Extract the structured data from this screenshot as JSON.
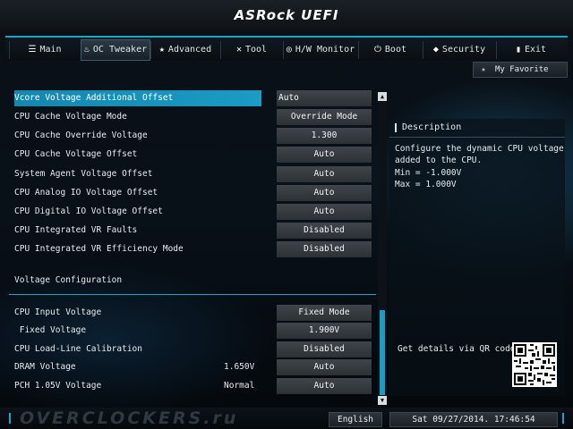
{
  "header": {
    "logo": "ASRock UEFI"
  },
  "tabs": [
    {
      "label": "Main",
      "icon": "list-icon",
      "glyph": "☰",
      "active": false
    },
    {
      "label": "OC Tweaker",
      "icon": "flame-icon",
      "glyph": "♨",
      "active": true
    },
    {
      "label": "Advanced",
      "icon": "star-icon",
      "glyph": "★",
      "active": false
    },
    {
      "label": "Tool",
      "icon": "tools-icon",
      "glyph": "✕",
      "active": false
    },
    {
      "label": "H/W Monitor",
      "icon": "monitor-icon",
      "glyph": "◎",
      "active": false
    },
    {
      "label": "Boot",
      "icon": "power-icon",
      "glyph": "⏻",
      "active": false
    },
    {
      "label": "Security",
      "icon": "shield-icon",
      "glyph": "◆",
      "active": false
    },
    {
      "label": "Exit",
      "icon": "exit-icon",
      "glyph": "▮",
      "active": false
    }
  ],
  "favorite": {
    "label": "My Favorite",
    "icon": "star-icon"
  },
  "settings": [
    {
      "name": "Vcore Voltage Additional Offset",
      "value": "Auto",
      "selected": true
    },
    {
      "name": "CPU Cache Voltage Mode",
      "value": "Override Mode"
    },
    {
      "name": "CPU Cache Override Voltage",
      "value": "1.300"
    },
    {
      "name": "CPU Cache Voltage Offset",
      "value": "Auto"
    },
    {
      "name": "System Agent Voltage Offset",
      "value": "Auto"
    },
    {
      "name": "CPU Analog IO Voltage Offset",
      "value": "Auto"
    },
    {
      "name": "CPU Digital IO Voltage Offset",
      "value": "Auto"
    },
    {
      "name": "CPU Integrated VR Faults",
      "value": "Disabled"
    },
    {
      "name": "CPU Integrated VR Efficiency Mode",
      "value": "Disabled"
    }
  ],
  "section": {
    "title": "Voltage Configuration"
  },
  "voltage_settings": [
    {
      "name": "CPU Input Voltage",
      "value": "Fixed Mode"
    },
    {
      "name": " Fixed Voltage",
      "value": "1.900V"
    },
    {
      "name": "CPU Load-Line Calibration",
      "value": "Disabled"
    },
    {
      "name": "DRAM Voltage",
      "current": "1.650V",
      "value": "Auto"
    },
    {
      "name": "PCH 1.05V Voltage",
      "current": "Normal",
      "value": "Auto"
    }
  ],
  "description": {
    "title": "Description",
    "lines": [
      "Configure the dynamic CPU voltage",
      "added to the CPU.",
      "Min = -1.000V",
      "Max = 1.000V"
    ],
    "qr_label": "Get details via QR code"
  },
  "footer": {
    "watermark": "OVERCLOCKERS.ru",
    "language": "English",
    "datetime": "Sat 09/27/2014. 17:46:54"
  },
  "colors": {
    "accent": "#1aa6c8",
    "selected": "#1587ad"
  }
}
